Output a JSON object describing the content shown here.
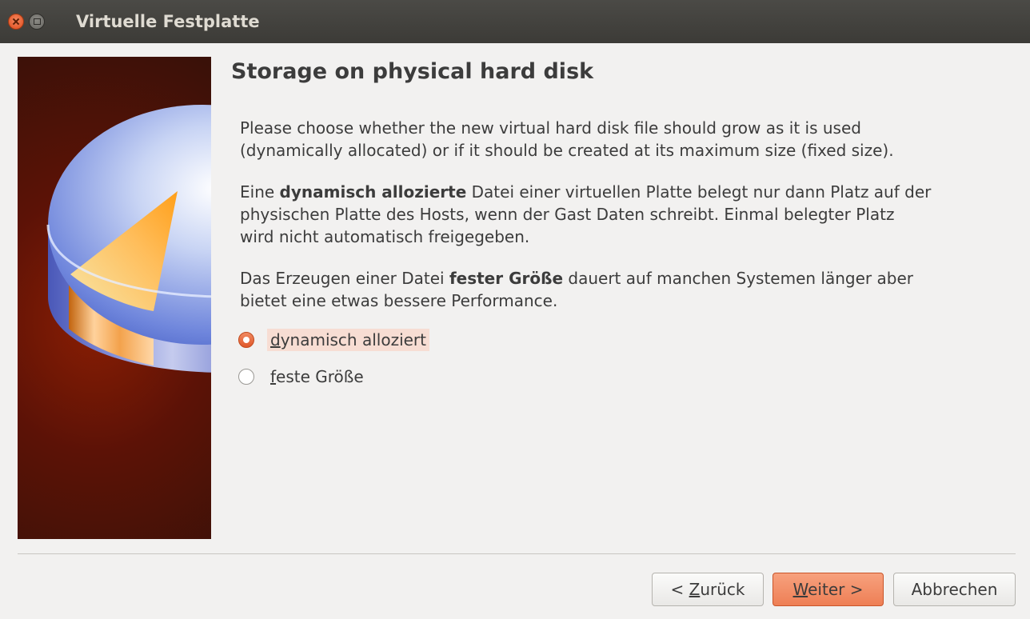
{
  "window": {
    "title": "Virtuelle Festplatte"
  },
  "page": {
    "heading": "Storage on physical hard disk",
    "paragraph1": {
      "line1": "Please choose whether the new virtual hard disk file should grow as it is used",
      "line2": "(dynamically allocated) or if it should be created at its maximum size (fixed size)."
    },
    "paragraph2": {
      "line1_before": "Eine ",
      "line1_bold": "dynamisch allozierte",
      "line1_after": " Datei einer virtuellen Platte belegt nur dann Platz auf der",
      "line2": "physischen Platte des Hosts, wenn der Gast Daten schreibt. Einmal belegter Platz",
      "line3": "wird nicht automatisch freigegeben."
    },
    "paragraph3": {
      "line1_before": "Das Erzeugen einer Datei ",
      "line1_bold": "fester Größe",
      "line1_after": " dauert auf manchen Systemen länger aber",
      "line2": "bietet eine etwas bessere Performance."
    }
  },
  "options": {
    "selected": "dynamisch allozierte",
    "dynamic": {
      "mnemonic": "d",
      "rest": "ynamisch alloziert"
    },
    "fixed": {
      "mnemonic": "f",
      "rest": "este Größe"
    }
  },
  "buttons": {
    "back": {
      "prefix": "< ",
      "mnemonic": "Z",
      "rest": "urück"
    },
    "next": {
      "mnemonic": "W",
      "rest": "eiter >"
    },
    "cancel": "Abbrechen"
  },
  "colors": {
    "accent": "#ee7f55",
    "titlebar": "#3c3b37",
    "background": "#f2f1f0",
    "text": "#3c3c3c"
  },
  "icons": {
    "close": "close-icon",
    "maximize": "maximize-icon",
    "side": "hard-disk-illustration"
  }
}
